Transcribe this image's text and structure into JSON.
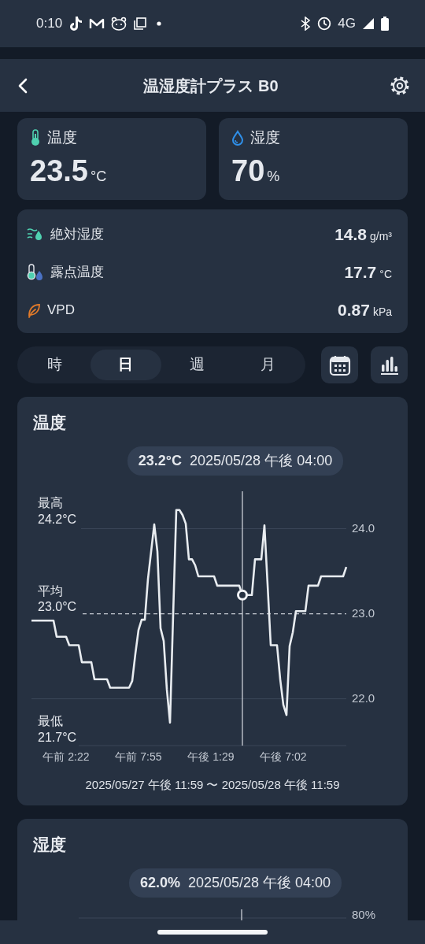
{
  "status_bar": {
    "time": "0:10",
    "network": "4G"
  },
  "header": {
    "title": "温湿度計プラス B0"
  },
  "readings": [
    {
      "kind": "temperature",
      "label": "温度",
      "value": "23.5",
      "unit": "°C"
    },
    {
      "kind": "humidity",
      "label": "湿度",
      "value": "70",
      "unit": "%"
    }
  ],
  "metrics": [
    {
      "kind": "absolute_humidity",
      "label": "絶対湿度",
      "value": "14.8",
      "unit": "g/m³"
    },
    {
      "kind": "dew_point",
      "label": "露点温度",
      "value": "17.7",
      "unit": "°C"
    },
    {
      "kind": "vpd",
      "label": "VPD",
      "value": "0.87",
      "unit": "kPa"
    }
  ],
  "period_tabs": [
    {
      "label": "時",
      "selected": false
    },
    {
      "label": "日",
      "selected": true
    },
    {
      "label": "週",
      "selected": false
    },
    {
      "label": "月",
      "selected": false
    }
  ],
  "charts": [
    {
      "title": "温度",
      "tooltip": {
        "value": "23.2°C",
        "time": "2025/05/28 午後 04:00"
      },
      "stats": [
        {
          "label": "最高",
          "value": "24.2°C"
        },
        {
          "label": "平均"
        },
        {
          "label": "最低",
          "value": "21.7°C"
        }
      ],
      "chart_data": {
        "type": "line",
        "ylim": [
          21.45,
          24.44
        ],
        "yticks": [
          {
            "value": 22,
            "label": "22.0"
          },
          {
            "value": 23,
            "label": "23.0"
          },
          {
            "value": 24,
            "label": "24.0"
          }
        ],
        "categories": [
          null,
          null,
          null,
          null,
          null,
          null,
          null,
          null,
          null,
          null,
          null,
          "午前 2:22",
          null,
          null,
          null,
          null,
          null,
          null,
          null,
          null,
          null,
          null,
          null,
          null,
          null,
          null,
          null,
          null,
          null,
          null,
          null,
          null,
          null,
          null,
          "午前 7:55",
          null,
          null,
          null,
          null,
          null,
          null,
          null,
          null,
          null,
          null,
          null,
          null,
          null,
          null,
          null,
          null,
          null,
          null,
          null,
          null,
          null,
          null,
          "午後 1:29",
          null,
          null,
          null,
          null,
          null,
          null,
          null,
          null,
          null,
          null,
          null,
          null,
          null,
          null,
          null,
          null,
          null,
          null,
          null,
          null,
          null,
          null,
          "午後 7:02",
          null,
          null,
          null,
          null,
          null,
          null,
          null,
          null,
          null,
          null,
          null,
          null,
          null,
          null,
          null,
          null,
          null,
          null,
          null,
          null
        ],
        "series": [
          {
            "color": "#e8ecf0",
            "values": [
              22.92,
              22.92,
              22.92,
              22.92,
              22.92,
              22.92,
              22.92,
              22.92,
              22.73,
              22.73,
              22.73,
              22.73,
              22.63,
              22.63,
              22.63,
              22.63,
              22.43,
              22.43,
              22.43,
              22.43,
              22.23,
              22.23,
              22.23,
              22.23,
              22.23,
              22.13,
              22.13,
              22.13,
              22.13,
              22.13,
              22.13,
              22.13,
              22.21,
              22.53,
              22.81,
              22.93,
              22.93,
              23.41,
              23.73,
              24.05,
              23.73,
              22.83,
              22.68,
              22.11,
              21.72,
              22.99,
              24.22,
              24.22,
              24.16,
              24.06,
              23.64,
              23.64,
              23.57,
              23.44,
              23.44,
              23.44,
              23.44,
              23.44,
              23.44,
              23.33,
              23.33,
              23.33,
              23.33,
              23.33,
              23.33,
              23.33,
              23.33,
              23.22,
              23.22,
              23.22,
              23.22,
              23.64,
              23.64,
              23.64,
              24.04,
              23.34,
              22.63,
              22.63,
              22.63,
              22.23,
              21.93,
              21.81,
              22.62,
              22.78,
              23.03,
              23.03,
              23.03,
              23.03,
              23.33,
              23.33,
              23.33,
              23.33,
              23.44,
              23.44,
              23.44,
              23.44,
              23.44,
              23.44,
              23.44,
              23.44,
              23.55
            ]
          }
        ],
        "ref_lines": [
          {
            "axis": "y",
            "value": 23,
            "label": "23.0°C"
          }
        ]
      },
      "range": "2025/05/27 午後 11:59 〜 2025/05/28 午後 11:59"
    },
    {
      "title": "湿度",
      "tooltip": {
        "value": "62.0%",
        "time": "2025/05/28 午後 04:00"
      },
      "axis_label": "80%"
    }
  ]
}
